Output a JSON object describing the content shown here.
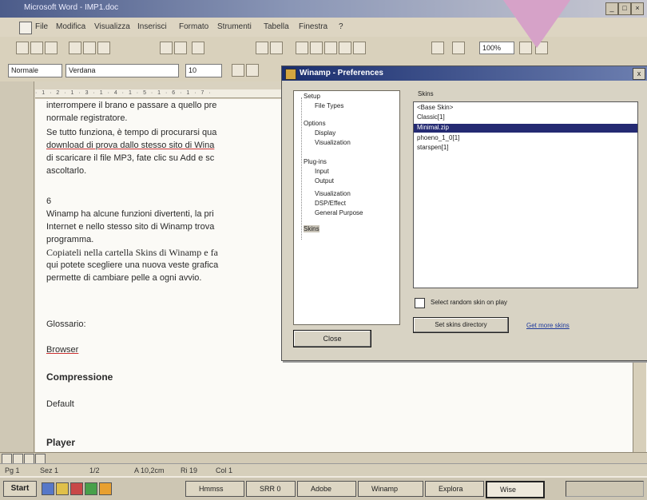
{
  "window": {
    "title": "Microsoft Word - IMP1.doc"
  },
  "menu": [
    "File",
    "Modifica",
    "Visualizza",
    "Inserisci",
    "Formato",
    "Strumenti",
    "Tabella",
    "Finestra",
    "?"
  ],
  "formatting": {
    "style": "Normale",
    "font": "Verdana",
    "size": "10",
    "zoom": "100%"
  },
  "ruler_text": "· 1 · 2 · 1 · 3 · 1 · 4 · 1 · 5 · 1 · 6 · 1 · 7 ·",
  "document": {
    "lines": [
      "interrompere il brano e passare a quello pre",
      "normale registratore.",
      "Se tutto funziona, è tempo di procurarsi qua",
      "download di prova dallo stesso sito di Wina",
      "di scaricare il file MP3, fate clic su Add e sc",
      "ascoltarlo.",
      "6",
      "Winamp ha alcune funzioni divertenti, la pri",
      "Internet e nello stesso sito di Winamp trova",
      "programma.",
      "Copiateli nella cartella Skins di Winamp e fa",
      "qui potete scegliere una nuova veste grafica",
      "permette di cambiare pelle a ogni avvio.",
      "Glossario:",
      "Browser",
      "Compressione",
      "Default",
      "Player"
    ]
  },
  "statusbar": [
    "Pg 1",
    "Sez 1",
    "1/2",
    "A 10,2cm",
    "Ri 19",
    "Col 1"
  ],
  "taskbar": {
    "start": "Start",
    "tasks": [
      "Hmmss",
      "SRR 0",
      "Adobe",
      "Winamp",
      "Explora",
      "Wise"
    ]
  },
  "dialog": {
    "title": "Winamp - Preferences",
    "close_x": "x",
    "tree": [
      {
        "label": "Setup",
        "level": 0
      },
      {
        "label": "File Types",
        "level": 1
      },
      {
        "label": "Options",
        "level": 0
      },
      {
        "label": "Display",
        "level": 1
      },
      {
        "label": "Visualization",
        "level": 1
      },
      {
        "label": "Plug-ins",
        "level": 0
      },
      {
        "label": "Input",
        "level": 1
      },
      {
        "label": "Output",
        "level": 1
      },
      {
        "label": "Visualization",
        "level": 1
      },
      {
        "label": "DSP/Effect",
        "level": 1
      },
      {
        "label": "General Purpose",
        "level": 1
      },
      {
        "label": "Skins",
        "level": 0,
        "selected": true
      }
    ],
    "close_button": "Close",
    "skins_label": "Skins",
    "skins": [
      "<Base Skin>",
      "Classic[1]",
      "Minimal.zip",
      "phoeno_1_0[1]",
      "starspen[1]"
    ],
    "selected_skin_index": 2,
    "random_skin_label": "Select random skin on play",
    "random_skin_checked": false,
    "set_dir_button": "Set skins directory",
    "get_more_link": "Get more skins"
  },
  "colors": {
    "overlay_arrow": "#d6a2c8",
    "selection": "#242a72",
    "title_active": "#1a2e6e"
  }
}
